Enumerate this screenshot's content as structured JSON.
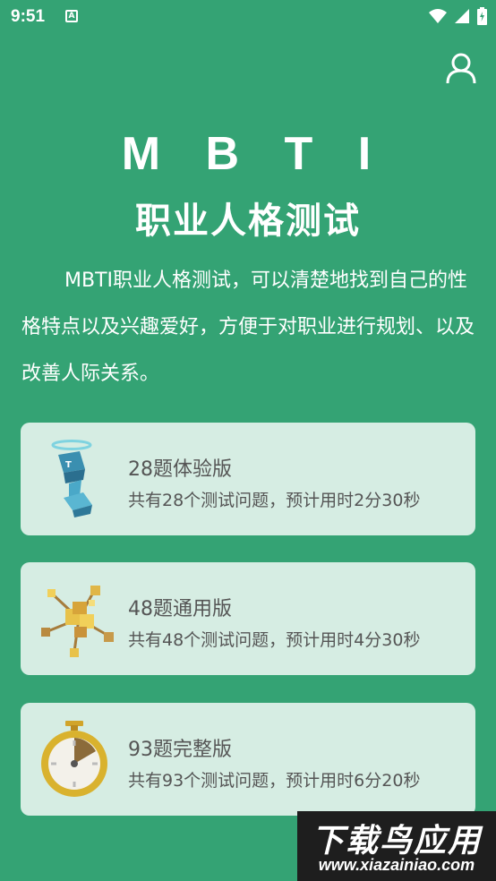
{
  "status": {
    "time": "9:51",
    "app_icon_letter": "A"
  },
  "header": {
    "title": "M B T I",
    "subtitle": "职业人格测试"
  },
  "intro": "MBTI职业人格测试，可以清楚地找到自己的性格特点以及兴趣爱好，方便于对职业进行规划、以及改善人际关系。",
  "cards": [
    {
      "title": "28题体验版",
      "desc": "共有28个测试问题，预计用时2分30秒",
      "icon": "block-figure-icon"
    },
    {
      "title": "48题通用版",
      "desc": "共有48个测试问题，预计用时4分30秒",
      "icon": "molecule-cubes-icon"
    },
    {
      "title": "93题完整版",
      "desc": "共有93个测试问题，预计用时6分20秒",
      "icon": "stopwatch-icon"
    }
  ],
  "watermark": {
    "title": "下载鸟应用",
    "url": "www.xiazainiao.com"
  },
  "colors": {
    "background": "#34a374",
    "card": "#d6ede3",
    "text_muted": "#555555"
  }
}
